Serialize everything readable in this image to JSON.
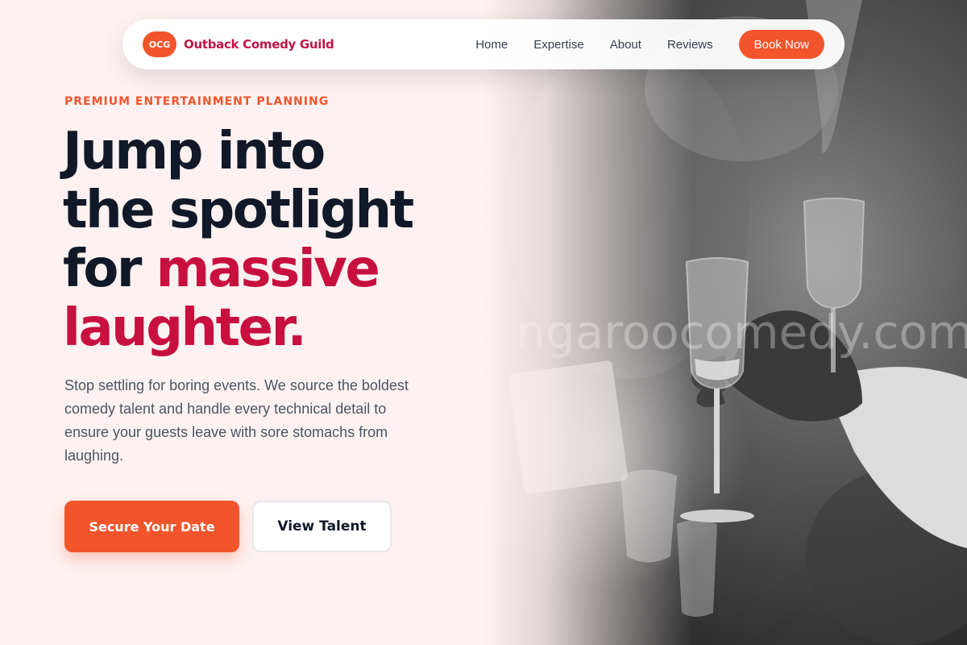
{
  "brand": {
    "badge": "OCG",
    "name": "Outback Comedy Guild"
  },
  "nav": {
    "links": [
      "Home",
      "Expertise",
      "About",
      "Reviews"
    ],
    "cta": "Book Now"
  },
  "hero": {
    "eyebrow": "PREMIUM ENTERTAINMENT PLANNING",
    "headline": {
      "line1": "Jump into",
      "line2": "the spotlight",
      "line3_plain": "for ",
      "line3_accent": "massive",
      "line4_accent": "laughter."
    },
    "description": "Stop settling for boring events. We source the boldest comedy talent and handle every technical detail to ensure your guests leave with sore stomachs from laughing.",
    "primary_button": "Secure Your Date",
    "secondary_button": "View Talent"
  },
  "image": {
    "watermark": "ngaroocomedy.com"
  },
  "colors": {
    "accent": "#f2552c",
    "brand": "#c01545",
    "headline_accent": "#c8103e",
    "background": "#fdf2f1"
  }
}
